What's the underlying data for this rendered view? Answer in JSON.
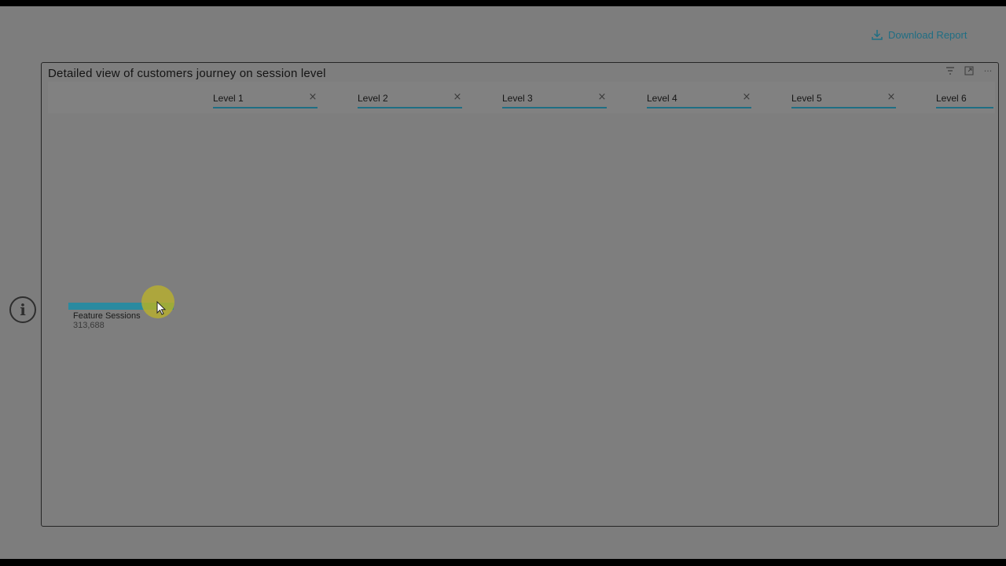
{
  "toolbar": {
    "download_label": "Download Report",
    "download_icon": "download-icon"
  },
  "info": {
    "icon": "info-icon",
    "glyph": "i"
  },
  "visual": {
    "title": "Detailed view of customers journey on session level",
    "tools": [
      {
        "name": "filter-icon",
        "glyph": "≡"
      },
      {
        "name": "focus-mode-icon",
        "glyph": "⤢"
      },
      {
        "name": "more-options-icon",
        "glyph": "···"
      }
    ],
    "levels": [
      {
        "label": "Level 1",
        "close": "×"
      },
      {
        "label": "Level 2",
        "close": "×"
      },
      {
        "label": "Level 3",
        "close": "×"
      },
      {
        "label": "Level 4",
        "close": "×"
      },
      {
        "label": "Level 5",
        "close": "×"
      },
      {
        "label": "Level 6",
        "close": ""
      }
    ]
  },
  "tree": {
    "root": {
      "label": "Feature Sessions",
      "value": "313,688"
    }
  },
  "colors": {
    "accent": "#1f6e84",
    "node_bar": "#2a8aa0",
    "cursor_highlight": "#bfb428",
    "overlay": "#7d7d7d"
  }
}
